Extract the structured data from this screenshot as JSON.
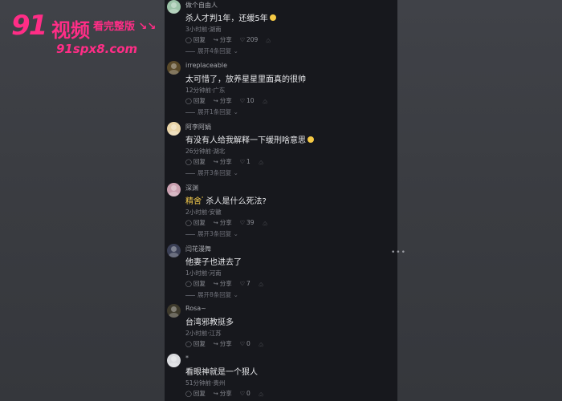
{
  "watermark": {
    "brand_number": "91",
    "brand_cn": "视频",
    "full_version": "看完整版",
    "arrows": "↘↘",
    "url": "91spx8.com",
    "color": "#ff2d86"
  },
  "actions": {
    "reply": "回复",
    "share": "分享"
  },
  "comments": [
    {
      "user": "做个自由人",
      "text": "杀人才判1年，还缓5年",
      "meta": "3小时前·湖南",
      "likes": "209",
      "expand": "展开4条回复",
      "emoji": true,
      "avatar_color": "#9cc3a8"
    },
    {
      "user": "irreplaceable",
      "text": "太可惜了，放养星星里面真的很帅",
      "meta": "12分钟前·广东",
      "likes": "10",
      "expand": "展开1条回复",
      "emoji": false,
      "avatar_color": "#5a4a2a"
    },
    {
      "user": "阿李阿娟",
      "text": "有没有人给我解释一下缓刑啥意思",
      "meta": "26分钟前·湖北",
      "likes": "1",
      "expand": "展开3条回复",
      "emoji": true,
      "avatar_color": "#e9d4a8"
    },
    {
      "user": "深渊",
      "tag": "精舍",
      "text": "杀人是什么死法?",
      "meta": "2小时前·安徽",
      "likes": "39",
      "expand": "展开3条回复",
      "emoji": false,
      "avatar_color": "#caa0b0"
    },
    {
      "user": "闫花漫舞",
      "text": "他妻子也进去了",
      "meta": "1小时前·河南",
      "likes": "7",
      "expand": "展开8条回复",
      "emoji": false,
      "avatar_color": "#3a3f55"
    },
    {
      "user": "Rosa~",
      "text": "台湾邪教挺多",
      "meta": "2小时前·江苏",
      "likes": "0",
      "expand": "",
      "emoji": false,
      "avatar_color": "#3e3a2c"
    },
    {
      "user": "*",
      "text": "看眼神就是一个狠人",
      "meta": "51分钟前·贵州",
      "likes": "0",
      "expand": "",
      "emoji": false,
      "avatar_color": "#d9dade"
    }
  ]
}
